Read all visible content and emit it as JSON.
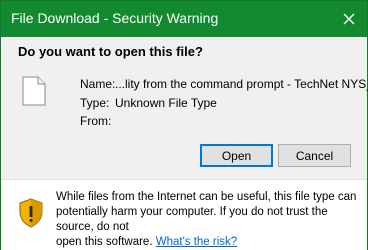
{
  "window": {
    "title": "File Download - Security Warning"
  },
  "dialog": {
    "question": "Do you want to open this file?",
    "fields": {
      "name_label": "Name:",
      "name_value": "...lity from the command prompt - TechNet NYS_url",
      "type_label": "Type:",
      "type_value": "Unknown File Type",
      "from_label": "From:",
      "from_value": ""
    },
    "buttons": {
      "open": "Open",
      "cancel": "Cancel"
    }
  },
  "footer": {
    "warning_line_1": "While files from the Internet can be useful, this file type can",
    "warning_line_2": "potentially harm your computer. If you do not trust the source, do not",
    "warning_line_3": "open this software.",
    "risk_link": "What's the risk?"
  },
  "icons": {
    "close": "close-icon",
    "file": "file-icon",
    "shield": "shield-warning-icon"
  },
  "colors": {
    "titlebar": "#138a2f",
    "primary_border": "#0078d7",
    "link": "#0066cc"
  }
}
